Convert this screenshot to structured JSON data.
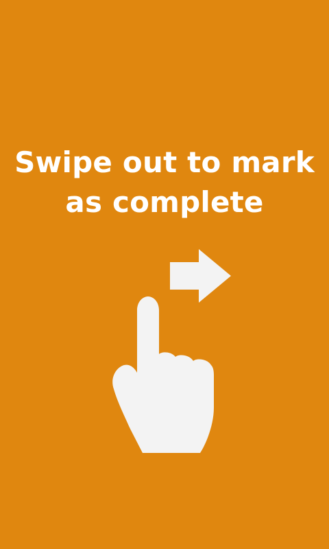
{
  "screen": {
    "background_color": "#e0870f",
    "icon_color": "#f3f3f3",
    "headline_lines": [
      "Swipe out to mark",
      "as complete"
    ],
    "gesture_icon": "swipe-right-hand-icon",
    "arrow_icon": "arrow-right-icon"
  }
}
